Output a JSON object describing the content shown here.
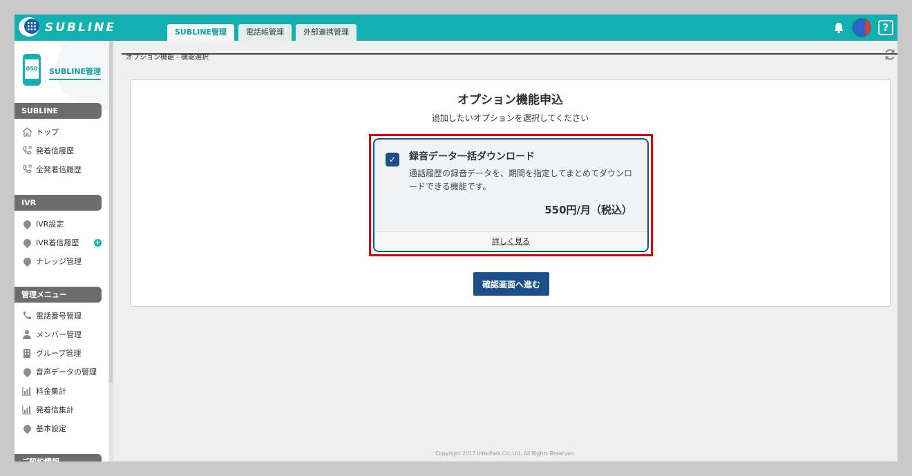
{
  "header": {
    "logo_text": "SUBLINE",
    "tabs": [
      {
        "label": "SUBLINE管理"
      },
      {
        "label": "電話帳管理"
      },
      {
        "label": "外部連携管理"
      }
    ],
    "help_label": "?"
  },
  "sidebar": {
    "phone_number_label": "050",
    "title": "SUBLINE管理",
    "sections": [
      {
        "title": "SUBLINE",
        "items": [
          {
            "label": "トップ",
            "icon": "home-icon"
          },
          {
            "label": "発着信履歴",
            "icon": "phone-history-icon"
          },
          {
            "label": "全発着信履歴",
            "icon": "phone-history-icon"
          }
        ]
      },
      {
        "title": "IVR",
        "items": [
          {
            "label": "IVR設定",
            "icon": "pin-icon"
          },
          {
            "label": "IVR着信履歴",
            "icon": "pin-icon",
            "badge": "+"
          },
          {
            "label": "ナレッジ管理",
            "icon": "pin-icon"
          }
        ]
      },
      {
        "title": "管理メニュー",
        "items": [
          {
            "label": "電話番号管理",
            "icon": "phone-icon"
          },
          {
            "label": "メンバー管理",
            "icon": "person-icon"
          },
          {
            "label": "グループ管理",
            "icon": "building-icon"
          },
          {
            "label": "音声データの管理",
            "icon": "pin-icon"
          },
          {
            "label": "料金集計",
            "icon": "bar-chart-icon"
          },
          {
            "label": "発着信集計",
            "icon": "bar-chart-icon"
          },
          {
            "label": "基本設定",
            "icon": "pin-icon"
          }
        ]
      },
      {
        "title": "ご契約情報",
        "items": []
      }
    ]
  },
  "main": {
    "breadcrumb": "オプション機能 - 機能選択",
    "panel": {
      "title": "オプション機能申込",
      "subtitle": "追加したいオプションを選択してください",
      "option": {
        "name": "録音データ一括ダウンロード",
        "description": "通話履歴の録音データを、期間を指定してまとめてダウンロードできる機能です。",
        "price": "550円/月（税込）",
        "more_link": "詳しく見る",
        "checked": true
      },
      "confirm_button": "確認画面へ進む"
    },
    "copyright": "Copyright 2017 InterPark Co.,Ltd. All Rights Reserved."
  },
  "colors": {
    "teal": "#12b0b0",
    "navy": "#1b4f8c",
    "highlight_red": "#e00000"
  }
}
